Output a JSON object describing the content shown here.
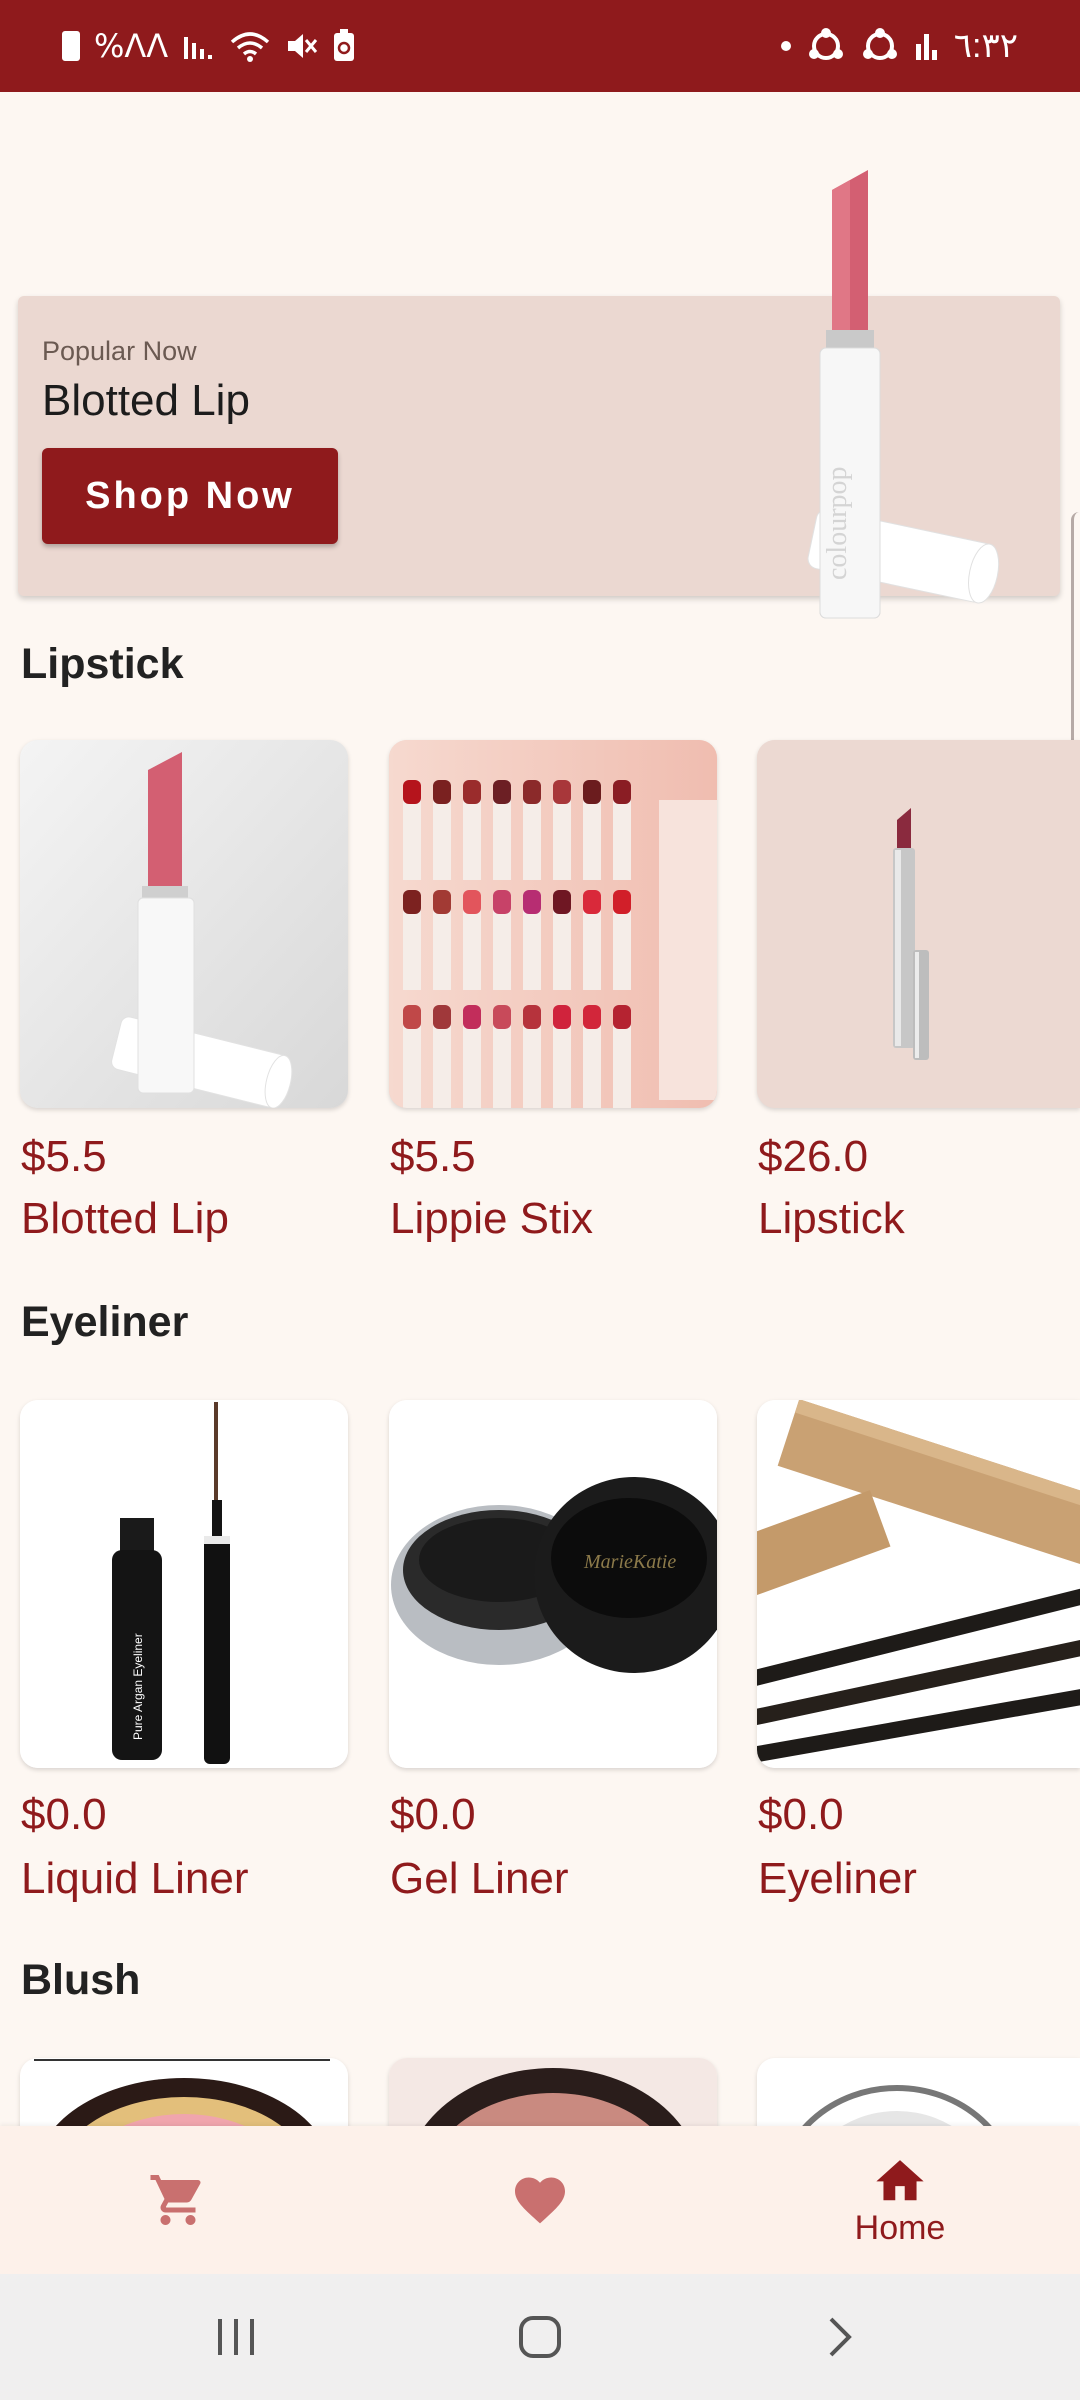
{
  "status_bar": {
    "left_text": "%ΛΛ",
    "time": "٦:٣٢"
  },
  "banner": {
    "subtitle": "Popular Now",
    "title": "Blotted Lip",
    "button_label": "Shop Now"
  },
  "sections": [
    {
      "title": "Lipstick",
      "items": [
        {
          "price": "$5.5",
          "name": "Blotted Lip"
        },
        {
          "price": "$5.5",
          "name": "Lippie Stix"
        },
        {
          "price": "$26.0",
          "name": "Lipstick"
        }
      ]
    },
    {
      "title": "Eyeliner",
      "items": [
        {
          "price": "$0.0",
          "name": "Liquid Liner"
        },
        {
          "price": "$0.0",
          "name": "Gel Liner"
        },
        {
          "price": "$0.0",
          "name": "Eyeliner"
        }
      ]
    },
    {
      "title": "Blush",
      "items": []
    }
  ],
  "bottom_nav": {
    "items": [
      {
        "icon": "cart-icon",
        "label": ""
      },
      {
        "icon": "heart-icon",
        "label": ""
      },
      {
        "icon": "home-icon",
        "label": "Home"
      }
    ]
  },
  "colors": {
    "brand": "#8f1a1c",
    "background": "#fdf7f2",
    "banner_bg": "#ebd8d1",
    "inactive_icon": "#c9706f"
  }
}
